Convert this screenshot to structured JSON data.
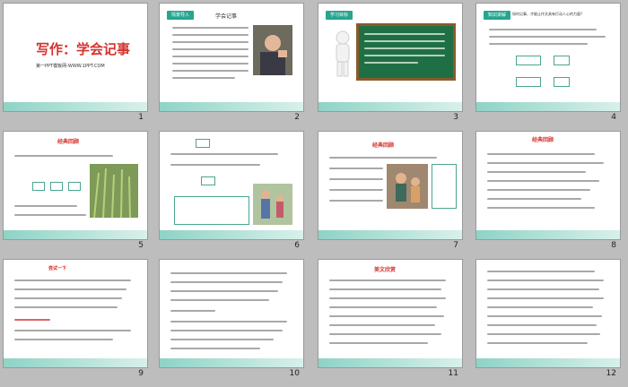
{
  "slides": [
    {
      "number": "1",
      "title": "写作：学会记事",
      "subtitle": "第一PPT模板网-WWW.1PPT.COM"
    },
    {
      "number": "2",
      "tag": "情景导入",
      "heading": "学会记事"
    },
    {
      "number": "3",
      "tag": "学习目标"
    },
    {
      "number": "4",
      "tag": "知识讲解",
      "heading": "如何记事，才能让作文具有打动人心的力量?"
    },
    {
      "number": "5",
      "heading": "经典回顾"
    },
    {
      "number": "6"
    },
    {
      "number": "7",
      "heading": "经典回顾"
    },
    {
      "number": "8",
      "heading": "经典回顾"
    },
    {
      "number": "9",
      "heading": "尝试一下"
    },
    {
      "number": "10"
    },
    {
      "number": "11",
      "heading": "美文欣赏"
    },
    {
      "number": "12"
    }
  ],
  "colors": {
    "accent": "#27a58f",
    "title_red": "#d6322e",
    "band": "#8fd3c6",
    "background": "#bdbdbd"
  }
}
